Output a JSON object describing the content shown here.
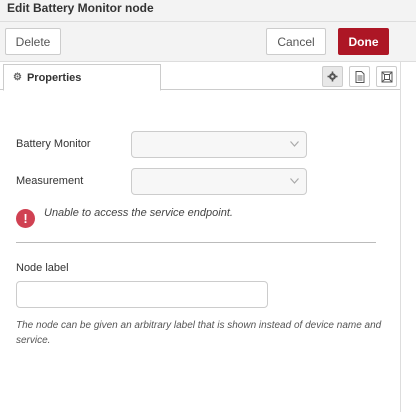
{
  "dialog": {
    "title": "Edit Battery Monitor node"
  },
  "toolbar": {
    "delete_label": "Delete",
    "cancel_label": "Cancel",
    "done_label": "Done"
  },
  "colors": {
    "done_button": "#ad1625",
    "error_icon": "#d04152"
  },
  "tabs": {
    "properties_label": "Properties",
    "icons": [
      "gear-icon",
      "document-icon",
      "frame-icon"
    ]
  },
  "form": {
    "battery_monitor_label": "Battery Monitor",
    "battery_monitor_value": "",
    "measurement_label": "Measurement",
    "measurement_value": "",
    "error_message": "Unable to access the service endpoint.",
    "node_label_label": "Node label",
    "node_label_value": "",
    "node_label_placeholder": "",
    "help_text": "The node can be given an arbitrary label that is shown instead of device name and service."
  }
}
